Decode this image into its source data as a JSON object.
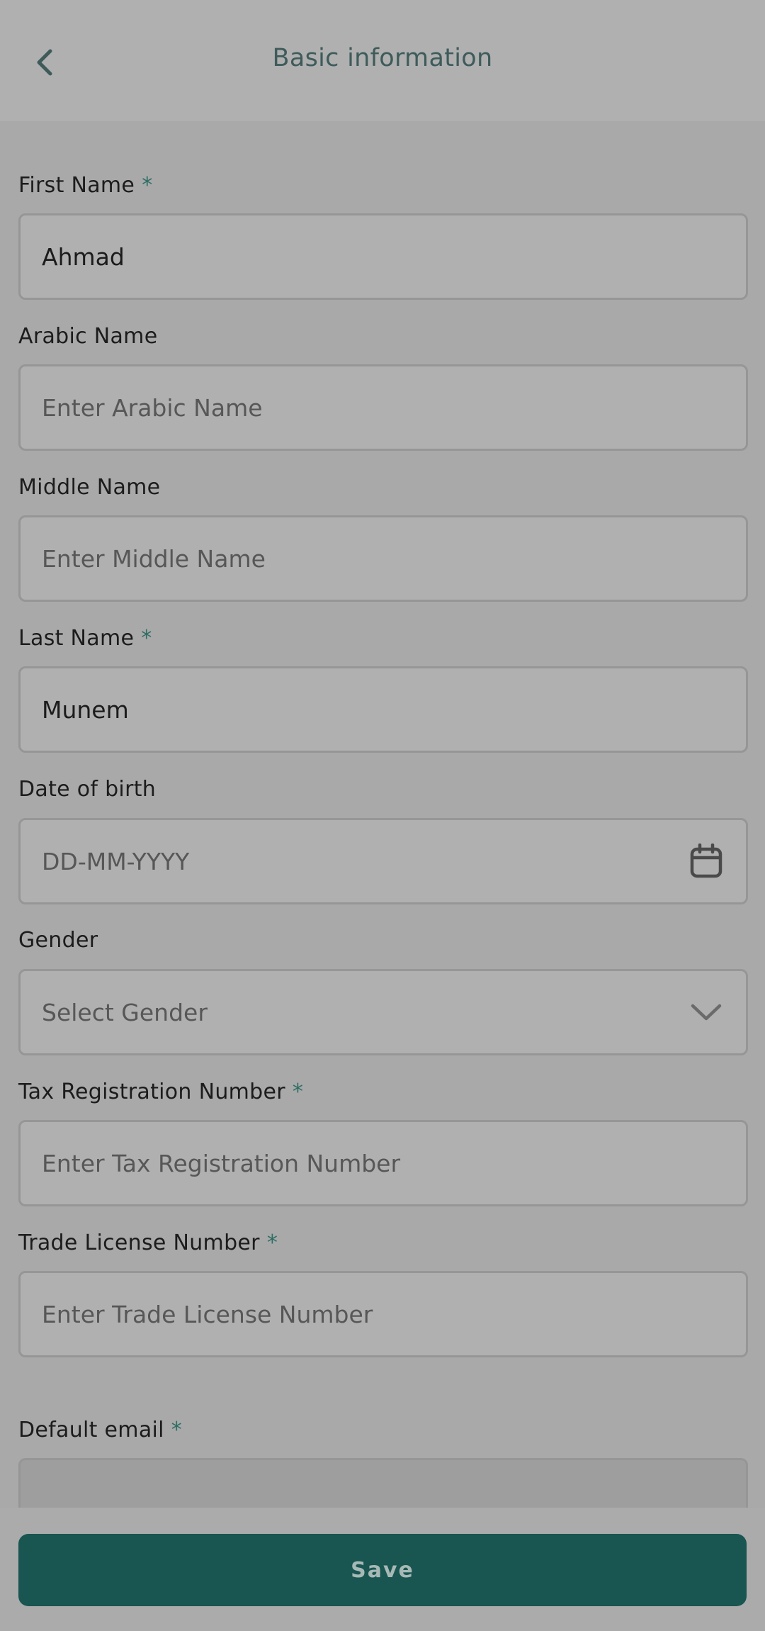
{
  "header": {
    "title": "Basic information",
    "back_icon": "chevron-left-icon"
  },
  "form": {
    "first_name": {
      "label": "First Name",
      "required_mark": "*",
      "value": "Ahmad"
    },
    "arabic_name": {
      "label": "Arabic Name",
      "placeholder": "Enter Arabic Name"
    },
    "middle_name": {
      "label": "Middle Name",
      "placeholder": "Enter Middle Name"
    },
    "last_name": {
      "label": "Last Name",
      "required_mark": "*",
      "value": "Munem"
    },
    "date_of_birth": {
      "label": "Date of birth",
      "placeholder": "DD-MM-YYYY",
      "icon": "calendar-icon"
    },
    "gender": {
      "label": "Gender",
      "placeholder": "Select Gender",
      "icon": "chevron-down-icon"
    },
    "tax_registration": {
      "label": "Tax Registration Number",
      "required_mark": "*",
      "placeholder": "Enter Tax Registration Number"
    },
    "trade_license": {
      "label": "Trade License Number",
      "required_mark": "*",
      "placeholder": "Enter Trade License Number"
    },
    "default_email": {
      "label": "Default email",
      "required_mark": "*"
    }
  },
  "footer": {
    "save_label": "Save"
  },
  "colors": {
    "accent": "#195551",
    "required": "#2e6e64",
    "title": "#3e5b5a"
  }
}
